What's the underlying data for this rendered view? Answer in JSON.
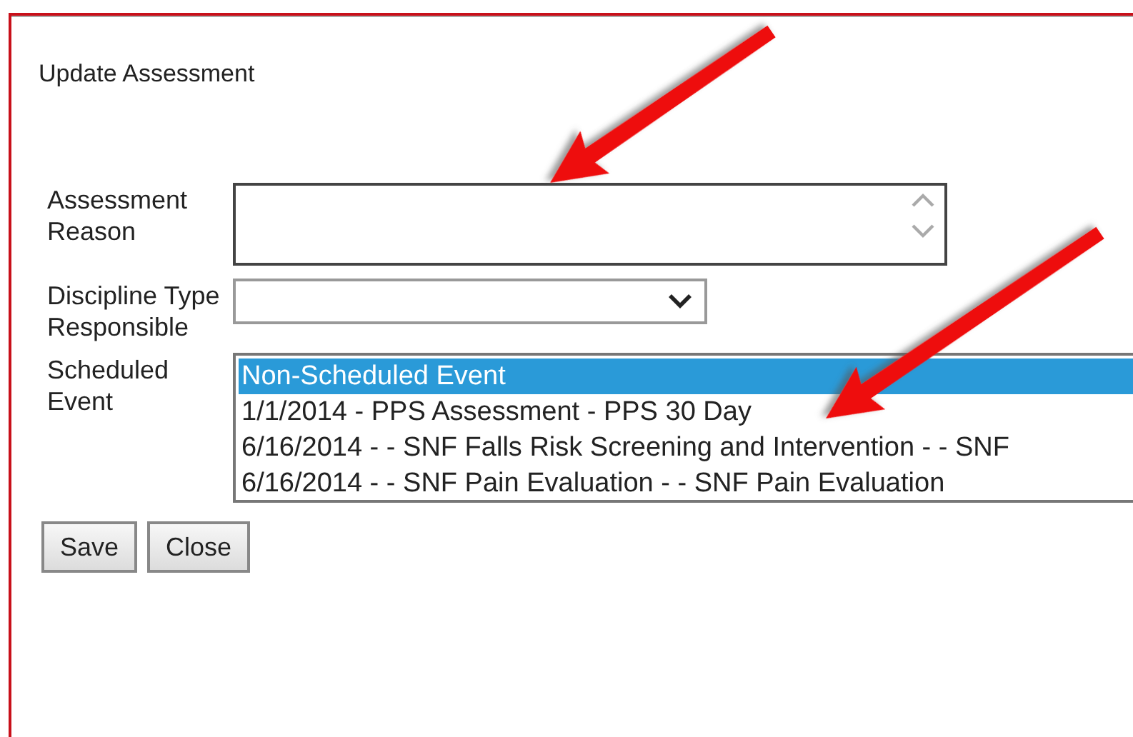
{
  "title": "Update Assessment",
  "fields": [
    {
      "kind": "textarea",
      "label": "Assessment Reason"
    },
    {
      "kind": "select",
      "label": "Discipline Type Responsible"
    },
    {
      "kind": "listbox",
      "label": "Scheduled Event",
      "options": [
        {
          "text": "Non-Scheduled Event",
          "selected": true
        },
        {
          "text": "1/1/2014 - PPS Assessment - PPS 30 Day",
          "selected": false
        },
        {
          "text": "6/16/2014 - - SNF Falls Risk Screening and Intervention - - SNF",
          "selected": false
        },
        {
          "text": "6/16/2014 - - SNF Pain Evaluation - - SNF Pain Evaluation",
          "selected": false
        }
      ]
    }
  ],
  "buttons": [
    "Save",
    "Close"
  ],
  "annotation_arrows": [
    {
      "kind": "arrow"
    },
    {
      "kind": "arrow"
    }
  ]
}
